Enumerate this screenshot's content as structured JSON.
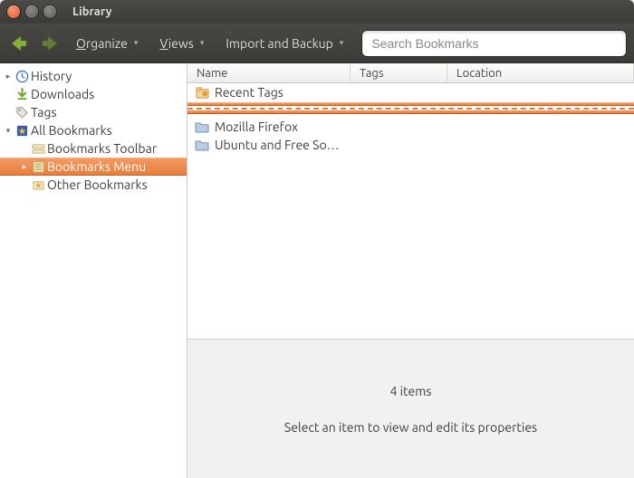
{
  "window": {
    "title": "Library"
  },
  "toolbar": {
    "organize": "Organize",
    "views": "Views",
    "import_backup": "Import and Backup",
    "search_placeholder": "Search Bookmarks"
  },
  "sidebar": {
    "history": "History",
    "downloads": "Downloads",
    "tags": "Tags",
    "all_bookmarks": "All Bookmarks",
    "toolbar": "Bookmarks Toolbar",
    "menu": "Bookmarks Menu",
    "other": "Other Bookmarks"
  },
  "columns": {
    "name": "Name",
    "tags": "Tags",
    "location": "Location"
  },
  "items": [
    {
      "name": "Recent Tags",
      "kind": "recent-tags"
    },
    {
      "name": "Mozilla Firefox",
      "kind": "folder"
    },
    {
      "name": "Ubuntu and Free So…",
      "kind": "folder"
    }
  ],
  "detail": {
    "count_text": "4 items",
    "hint": "Select an item to view and edit its properties"
  }
}
